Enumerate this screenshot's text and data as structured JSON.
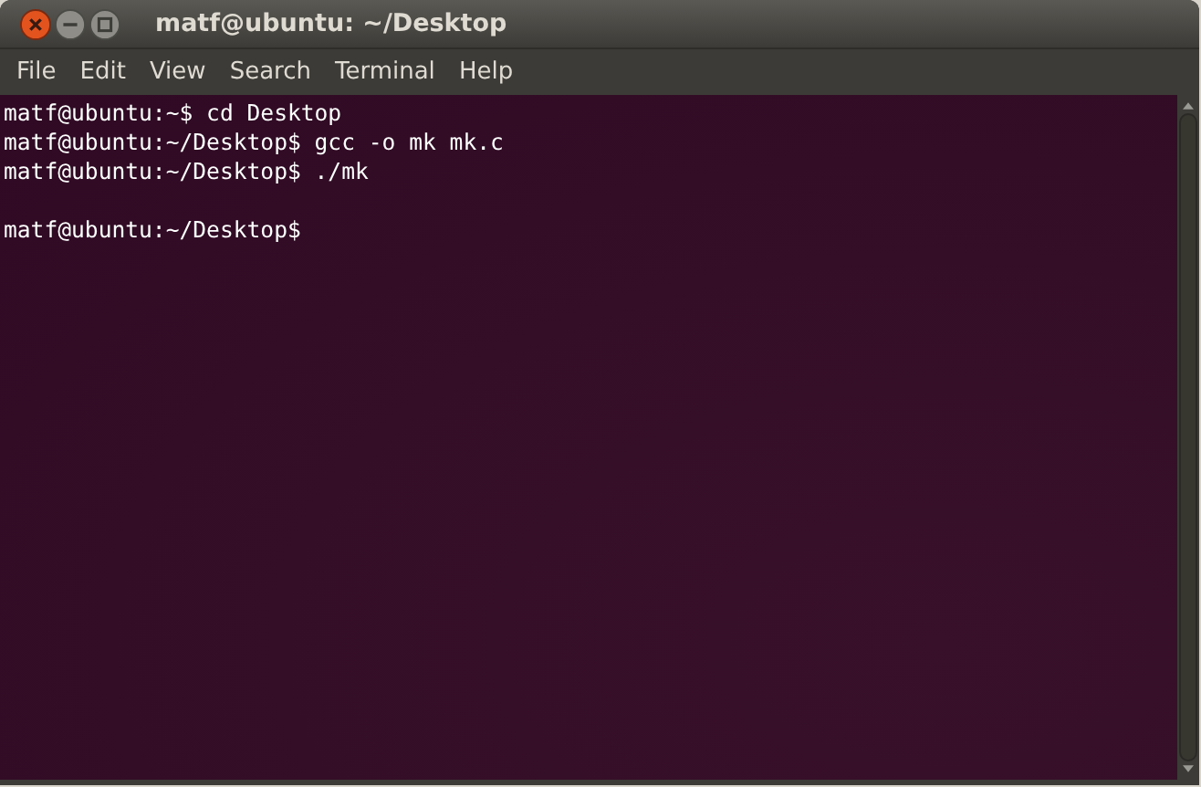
{
  "window": {
    "title": "matf@ubuntu: ~/Desktop"
  },
  "menu": [
    "File",
    "Edit",
    "View",
    "Search",
    "Terminal",
    "Help"
  ],
  "terminal": {
    "lines": [
      {
        "kind": "line",
        "text": "matf@ubuntu:~$ cd Desktop"
      },
      {
        "kind": "line",
        "text": "matf@ubuntu:~/Desktop$ gcc -o mk mk.c"
      },
      {
        "kind": "line",
        "text": "matf@ubuntu:~/Desktop$ ./mk"
      },
      {
        "kind": "blank"
      },
      {
        "kind": "line",
        "text": "matf@ubuntu:~/Desktop$"
      }
    ]
  }
}
